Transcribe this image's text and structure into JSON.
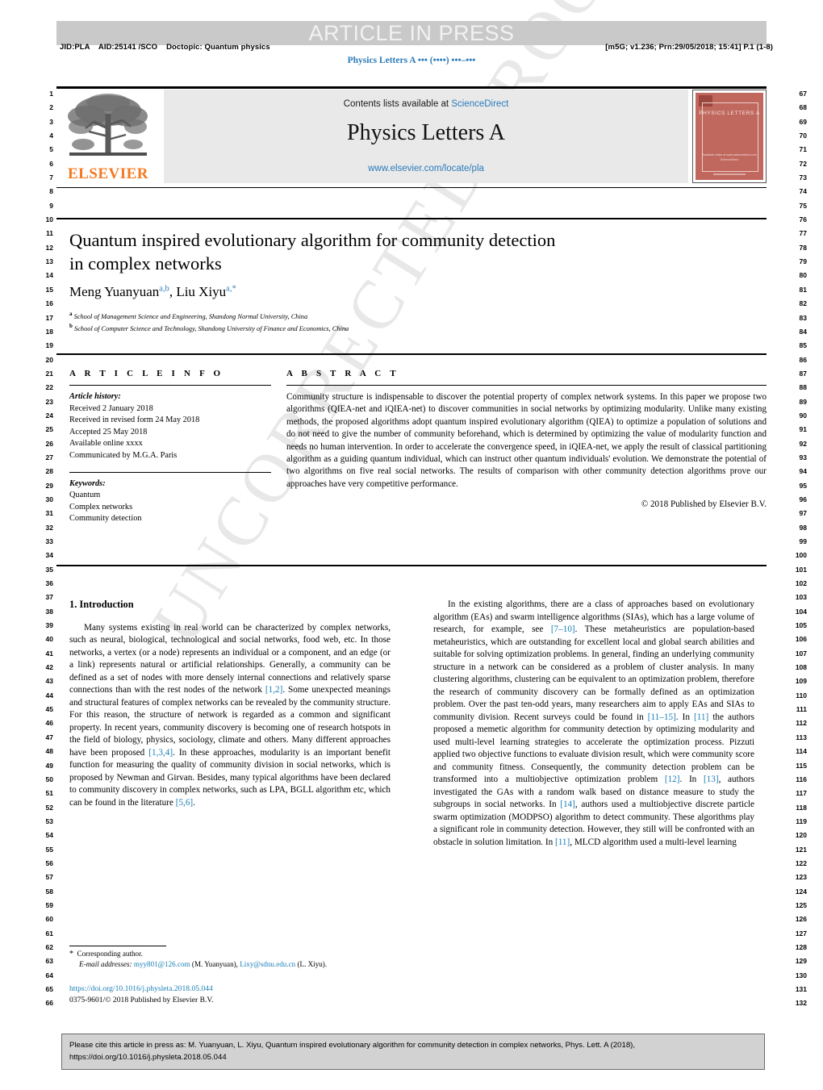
{
  "banner": {
    "text": "ARTICLE IN PRESS"
  },
  "proof_marks": {
    "jid_line": "JID:PLA    AID:25141 /SCO    Doctopic: Quantum physics",
    "print_line": "[m5G; v1.236; Prn:29/05/2018; 15:41] P.1 (1-8)",
    "running_head": "Physics Letters A ••• (••••) •••–•••",
    "watermark": "UNCORRECTED PROOF"
  },
  "masthead": {
    "contents_prefix": "Contents lists available at ",
    "sciencedirect": "ScienceDirect",
    "journal_title": "Physics Letters A",
    "journal_url": "www.elsevier.com/locate/pla",
    "publisher": "ELSEVIER",
    "cover_title": "PHYSICS LETTERS A",
    "cover_footer": "Available online at www.sciencedirect.com\nScienceDirect"
  },
  "article": {
    "title_line1": "Quantum inspired evolutionary algorithm for community detection",
    "title_line2": "in complex networks",
    "author1": "Meng Yuanyuan",
    "author1_sup": "a,b",
    "author2": "Liu Xiyu",
    "author2_sup": "a,*",
    "affiliation_a_sup": "a",
    "affiliation_a": "School of Management Science and Engineering, Shandong Normal University, China",
    "affiliation_b_sup": "b",
    "affiliation_b": "School of Computer Science and Technology, Shandong University of Finance and Economics, China"
  },
  "info": {
    "heading": "A R T I C L E   I N F O",
    "history_label": "Article history:",
    "history": [
      "Received 2 January 2018",
      "Received in revised form 24 May 2018",
      "Accepted 25 May 2018",
      "Available online xxxx",
      "Communicated by M.G.A. Paris"
    ],
    "keywords_label": "Keywords:",
    "keywords": [
      "Quantum",
      "Complex networks",
      "Community detection"
    ]
  },
  "abstract": {
    "heading": "A B S T R A C T",
    "text": "Community structure is indispensable to discover the potential property of complex network systems. In this paper we propose two algorithms (QIEA-net and iQIEA-net) to discover communities in social networks by optimizing modularity. Unlike many existing methods, the proposed algorithms adopt quantum inspired evolutionary algorithm (QIEA) to optimize a population of solutions and do not need to give the number of community beforehand, which is determined by optimizing the value of modularity function and needs no human intervention. In order to accelerate the convergence speed, in iQIEA-net, we apply the result of classical partitioning algorithm as a guiding quantum individual, which can instruct other quantum individuals' evolution. We demonstrate the potential of two algorithms on five real social networks. The results of comparison with other community detection algorithms prove our approaches have very competitive performance.",
    "copyright": "© 2018 Published by Elsevier B.V."
  },
  "body": {
    "section_heading": "1. Introduction",
    "left_paragraph_1": "Many systems existing in real world can be characterized by complex networks, such as neural, biological, technological and social networks, food web, etc. In those networks, a vertex (or a node) represents an individual or a component, and an edge (or a link) represents natural or artificial relationships. Generally, a community can be defined as a set of nodes with more densely internal connections and relatively sparse connections than with the rest nodes of the network ",
    "left_cite_1": "[1,2]",
    "left_paragraph_1b": ". Some unexpected meanings and structural features of complex networks can be revealed by the community structure. For this reason, the structure of network is regarded as a common and significant property. In recent years, community discovery is becoming one of research hotspots in the field of biology, physics, sociology, climate and others. Many different approaches have been proposed ",
    "left_cite_2": "[1,3,4]",
    "left_paragraph_1c": ". In these approaches, modularity is an important benefit function for measuring the quality of community division in social networks, which is proposed by Newman and Girvan. Besides, many typical algorithms have been declared to community discovery in complex networks, such as LPA, BGLL algorithm etc, which can be found in the literature ",
    "left_cite_3": "[5,6]",
    "left_paragraph_1d": ".",
    "right_paragraph_1": "In the existing algorithms, there are a class of approaches based on evolutionary algorithm (EAs) and swarm intelligence algorithms (SIAs), which has a large volume of research, for example, see ",
    "right_cite_1": "[7–10]",
    "right_paragraph_1b": ". These metaheuristics are population-based metaheuristics, which are outstanding for excellent local and global search abilities and suitable for solving optimization problems. In general, finding an underlying community structure in a network can be considered as a problem of cluster analysis. In many clustering algorithms, clustering can be equivalent to an optimization problem, therefore the research of community discovery can be formally defined as an optimization problem. Over the past ten-odd years, many researchers aim to apply EAs and SIAs to community division. Recent surveys could be found in ",
    "right_cite_2": "[11–15]",
    "right_paragraph_1c": ". In ",
    "right_cite_3": "[11]",
    "right_paragraph_1d": " the authors proposed a memetic algorithm for community detection by optimizing modularity and used multi-level learning strategies to accelerate the optimization process. Pizzuti applied two objective functions to evaluate division result, which were community score and community fitness. Consequently, the community detection problem can be transformed into a multiobjective optimization problem ",
    "right_cite_4": "[12]",
    "right_paragraph_1e": ". In ",
    "right_cite_5": "[13]",
    "right_paragraph_1f": ", authors investigated the GAs with a random walk based on distance measure to study the subgroups in social networks. In ",
    "right_cite_6": "[14]",
    "right_paragraph_1g": ", authors used a multiobjective discrete particle swarm optimization (MODPSO) algorithm to detect community. These algorithms play a significant role in community detection. However, they still will be confronted with an obstacle in solution limitation. In ",
    "right_cite_7": "[11]",
    "right_paragraph_1h": ", MLCD algorithm used a multi-level learning"
  },
  "footnote": {
    "star": "*",
    "corresponding": "Corresponding author.",
    "emails_label": "E-mail addresses:",
    "email1": "myy801@126.com",
    "email1_owner": "(M. Yuanyuan),",
    "email2": "Lixy@sdnu.edu.cn",
    "email2_owner": "(L. Xiyu).",
    "doi": "https://doi.org/10.1016/j.physleta.2018.05.044",
    "issn_line": "0375-9601/© 2018 Published by Elsevier B.V."
  },
  "citation_box": {
    "line1": "Please cite this article in press as: M. Yuanyuan, L. Xiyu, Quantum inspired evolutionary algorithm for community detection in complex networks, Phys. Lett. A (2018),",
    "line2": "https://doi.org/10.1016/j.physleta.2018.05.044"
  },
  "line_numbers": {
    "left_start": 1,
    "left_end": 66,
    "right_start": 67,
    "right_end": 132
  },
  "colors": {
    "link": "#2b7bba",
    "citation": "#1a7fb5",
    "elsevier_orange": "#f47920",
    "banner_grey": "#c9c9c9",
    "cover_red": "#c0685e"
  }
}
